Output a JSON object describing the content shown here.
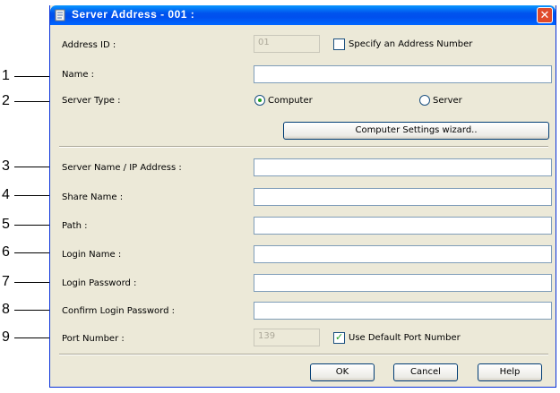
{
  "window": {
    "title": "Server Address - 001 :",
    "close_glyph": "✕"
  },
  "address_id": {
    "label": "Address ID :",
    "value": "01"
  },
  "specify_number": {
    "label": "Specify an Address Number",
    "checked": false
  },
  "name": {
    "label": "Name :",
    "value": ""
  },
  "server_type": {
    "label": "Server Type :",
    "options": [
      "Computer",
      "Server"
    ],
    "selected": "Computer"
  },
  "wizard_button": "Computer Settings wizard..",
  "server_name": {
    "label": "Server Name / IP Address :",
    "value": ""
  },
  "share_name": {
    "label": "Share Name :",
    "value": ""
  },
  "path": {
    "label": "Path :",
    "value": ""
  },
  "login_name": {
    "label": "Login Name :",
    "value": ""
  },
  "login_password": {
    "label": "Login Password :",
    "value": ""
  },
  "confirm_password": {
    "label": "Confirm Login Password :",
    "value": ""
  },
  "port_number": {
    "label": "Port Number :",
    "value": "139"
  },
  "use_default_port": {
    "label": "Use Default Port Number",
    "checked": true
  },
  "buttons": {
    "ok": "OK",
    "cancel": "Cancel",
    "help": "Help"
  },
  "callouts": [
    "1",
    "2",
    "3",
    "4",
    "5",
    "6",
    "7",
    "8",
    "9"
  ]
}
